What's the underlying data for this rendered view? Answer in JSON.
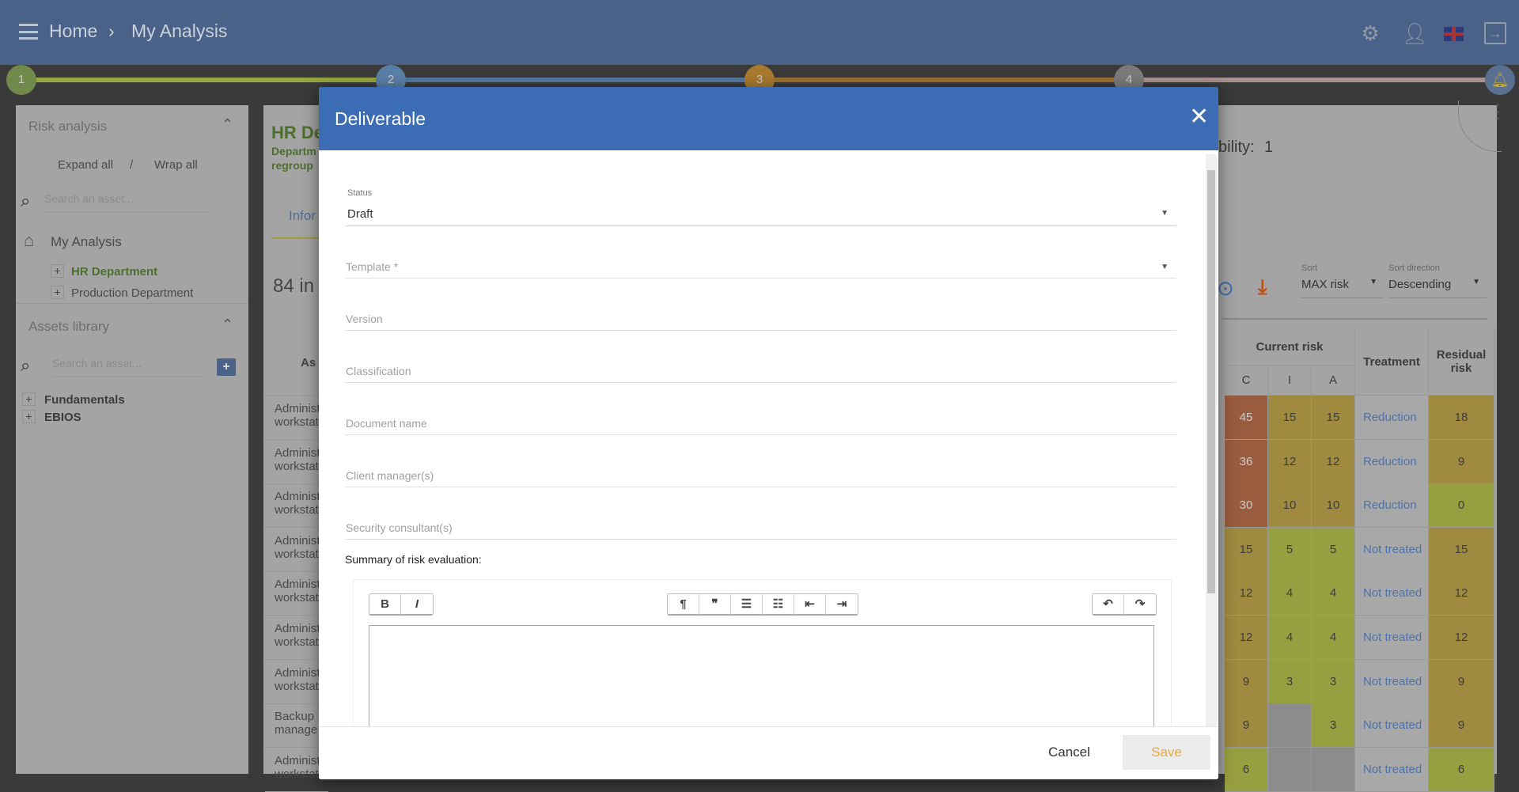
{
  "header": {
    "breadcrumb": [
      "Home",
      "My Analysis"
    ],
    "icons": [
      "menu-icon",
      "gear-icon",
      "user-icon",
      "uk-flag-icon",
      "logout-icon"
    ]
  },
  "stepper": {
    "steps": [
      "1",
      "2",
      "3",
      "4"
    ],
    "colors": [
      "#6f8a4a",
      "#5a7fa6",
      "#a7792f",
      "#7a7a7a"
    ],
    "line_colors": [
      "#97a63f",
      "#56789f",
      "#9b7030",
      "#a89090"
    ]
  },
  "sidebar": {
    "risk_analysis": {
      "title": "Risk analysis",
      "expand_all": "Expand all",
      "separator": "/",
      "wrap_all": "Wrap all",
      "search_placeholder": "Search an asset...",
      "root": "My Analysis",
      "items": [
        "HR Department",
        "Production Department"
      ]
    },
    "assets_library": {
      "title": "Assets library",
      "search_placeholder": "Search an asset...",
      "items": [
        "Fundamentals",
        "EBIOS"
      ]
    }
  },
  "main": {
    "card_title": "HR De",
    "card_sub1": "Departm",
    "card_sub2": "regroup",
    "probability_label": "bility:",
    "probability_value": "1",
    "tab": "Infor",
    "count": "84 in",
    "sort": {
      "label": "Sort",
      "value": "MAX risk",
      "direction_label": "Sort direction",
      "direction_value": "Descending"
    },
    "table": {
      "asset_header": "As",
      "current_risk": "Current risk",
      "cols": [
        "C",
        "I",
        "A"
      ],
      "treatment": "Treatment",
      "residual": "Residual risk",
      "rows": [
        {
          "asset": [
            "Administ",
            "workstat"
          ],
          "c": "45",
          "i": "15",
          "a": "15",
          "t": "Reduction",
          "r": "18",
          "cc": "#9a5c3e",
          "ic": "#a08a40",
          "ac": "#a08a40",
          "rc": "#a08a40"
        },
        {
          "asset": [
            "Administ",
            "workstat"
          ],
          "c": "36",
          "i": "12",
          "a": "12",
          "t": "Reduction",
          "r": "9",
          "cc": "#9a5c3e",
          "ic": "#a08a40",
          "ac": "#a08a40",
          "rc": "#a08a40"
        },
        {
          "asset": [
            "Administ",
            "workstat"
          ],
          "c": "30",
          "i": "10",
          "a": "10",
          "t": "Reduction",
          "r": "0",
          "cc": "#9a5c3e",
          "ic": "#a08a40",
          "ac": "#a08a40",
          "rc": "#97a040"
        },
        {
          "asset": [
            "Administ",
            "workstat"
          ],
          "c": "15",
          "i": "5",
          "a": "5",
          "t": "Not treated",
          "r": "15",
          "cc": "#a08a40",
          "ic": "#97a040",
          "ac": "#97a040",
          "rc": "#a08a40"
        },
        {
          "asset": [
            "Administ",
            "workstat"
          ],
          "c": "12",
          "i": "4",
          "a": "4",
          "t": "Not treated",
          "r": "12",
          "cc": "#a08a40",
          "ic": "#97a040",
          "ac": "#97a040",
          "rc": "#a08a40"
        },
        {
          "asset": [
            "Administ",
            "workstat"
          ],
          "c": "12",
          "i": "4",
          "a": "4",
          "t": "Not treated",
          "r": "12",
          "cc": "#a08a40",
          "ic": "#97a040",
          "ac": "#97a040",
          "rc": "#a08a40"
        },
        {
          "asset": [
            "Administ",
            "workstat"
          ],
          "c": "9",
          "i": "3",
          "a": "3",
          "t": "Not treated",
          "r": "9",
          "cc": "#a08a40",
          "ic": "#97a040",
          "ac": "#97a040",
          "rc": "#a08a40"
        },
        {
          "asset": [
            "Backup",
            "manage"
          ],
          "c": "9",
          "i": "",
          "a": "3",
          "t": "Not treated",
          "r": "9",
          "cc": "#a08a40",
          "ic": "#8c8c8c",
          "ac": "#97a040",
          "rc": "#a08a40"
        },
        {
          "asset": [
            "Administ",
            "workstat"
          ],
          "c": "6",
          "i": "",
          "a": "",
          "t": "Not treated",
          "r": "6",
          "cc": "#97a040",
          "ic": "#8c8c8c",
          "ac": "#8c8c8c",
          "rc": "#97a040"
        }
      ]
    }
  },
  "modal": {
    "title": "Deliverable",
    "status": {
      "label": "Status",
      "value": "Draft"
    },
    "fields": [
      "Template *",
      "Version",
      "Classification",
      "Document name",
      "Client manager(s)",
      "Security consultant(s)"
    ],
    "summary_label": "Summary of risk evaluation:",
    "toolbar": {
      "bold": "B",
      "italic": "I",
      "heading": "¶",
      "quote": "❞",
      "bullets": "☰",
      "numbered": "☷",
      "outdent": "⇤",
      "indent": "⇥",
      "undo": "↶",
      "redo": "↷"
    },
    "cancel": "Cancel",
    "save": "Save"
  }
}
